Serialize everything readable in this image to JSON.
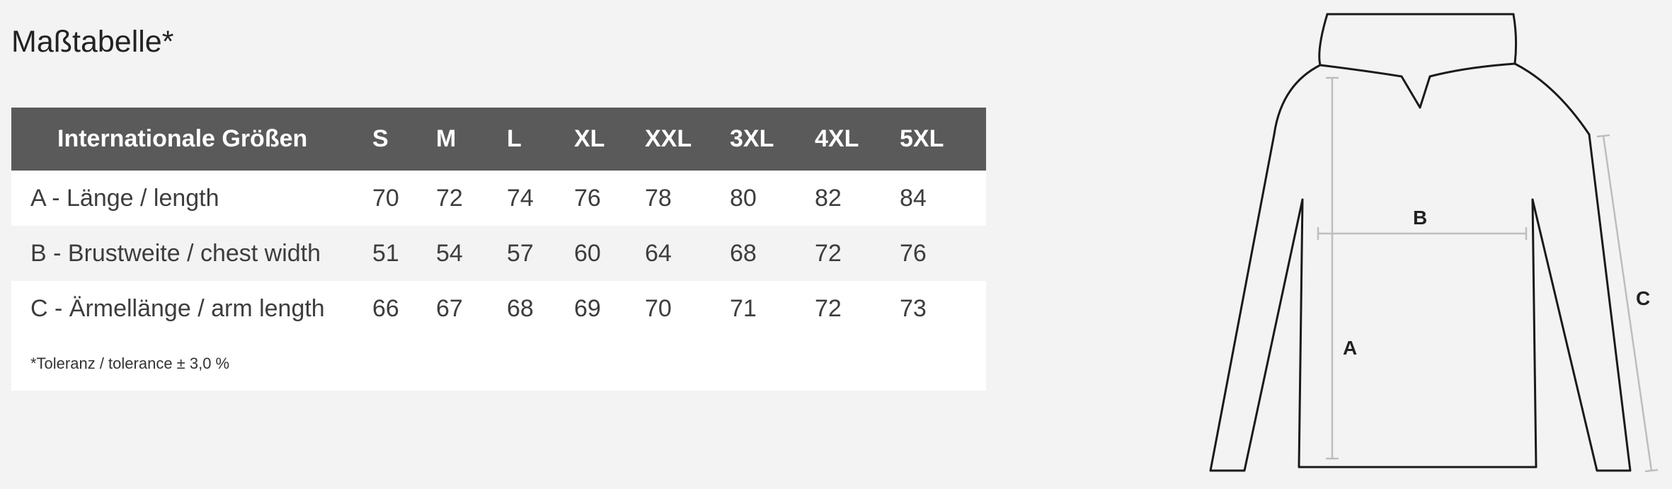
{
  "title": "Maßtabelle*",
  "table": {
    "header": [
      "Internationale Größen",
      "S",
      "M",
      "L",
      "XL",
      "XXL",
      "3XL",
      "4XL",
      "5XL"
    ],
    "rows": [
      {
        "label": "A - Länge / length",
        "values": [
          "70",
          "72",
          "74",
          "76",
          "78",
          "80",
          "82",
          "84"
        ]
      },
      {
        "label": "B - Brustweite / chest width",
        "values": [
          "51",
          "54",
          "57",
          "60",
          "64",
          "68",
          "72",
          "76"
        ]
      },
      {
        "label": "C - Ärmellänge / arm length",
        "values": [
          "66",
          "67",
          "68",
          "69",
          "70",
          "71",
          "72",
          "73"
        ]
      }
    ],
    "note": "*Toleranz / tolerance ± 3,0 %"
  },
  "figure": {
    "labels": {
      "a": "A",
      "b": "B",
      "c": "C"
    },
    "colors": {
      "outline": "#1a1a1a",
      "measure": "#bdbdbd"
    }
  },
  "colors": {
    "header_bg": "#5a5a5a",
    "page_bg": "#f3f3f3",
    "row_white": "#ffffff"
  }
}
